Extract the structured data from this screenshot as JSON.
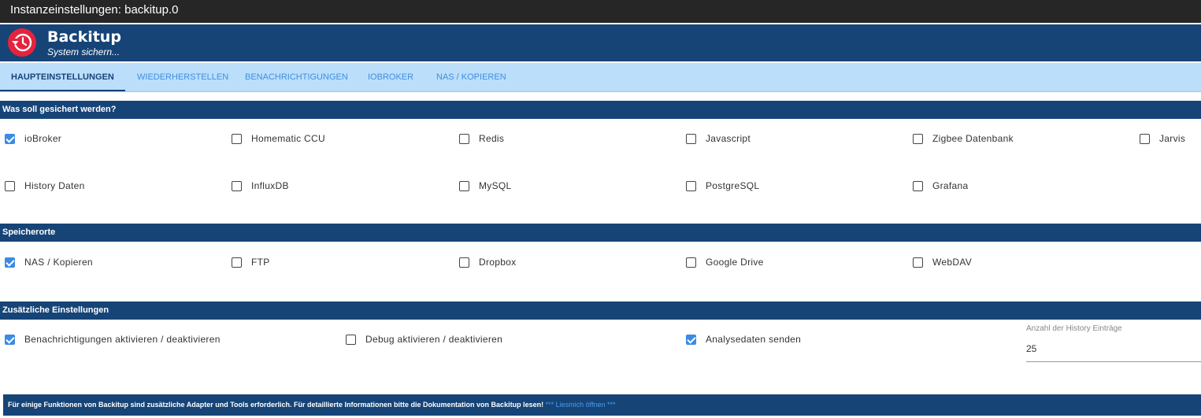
{
  "window": {
    "title": "Instanzeinstellungen: backitup.0"
  },
  "app": {
    "name": "Backitup",
    "subtitle": "System sichern..."
  },
  "tabs": [
    {
      "label": "HAUPTEINSTELLUNGEN",
      "active": true
    },
    {
      "label": "WIEDERHERSTELLEN",
      "active": false
    },
    {
      "label": "BENACHRICHTIGUNGEN",
      "active": false
    },
    {
      "label": "IOBROKER",
      "active": false
    },
    {
      "label": "NAS / KOPIEREN",
      "active": false
    }
  ],
  "sections": {
    "backup": {
      "title": "Was soll gesichert werden?",
      "items": [
        {
          "label": "ioBroker",
          "checked": true
        },
        {
          "label": "Homematic CCU",
          "checked": false
        },
        {
          "label": "Redis",
          "checked": false
        },
        {
          "label": "Javascript",
          "checked": false
        },
        {
          "label": "Zigbee Datenbank",
          "checked": false
        },
        {
          "label": "Jarvis",
          "checked": false
        },
        {
          "label": "History Daten",
          "checked": false
        },
        {
          "label": "InfluxDB",
          "checked": false
        },
        {
          "label": "MySQL",
          "checked": false
        },
        {
          "label": "PostgreSQL",
          "checked": false
        },
        {
          "label": "Grafana",
          "checked": false
        }
      ]
    },
    "storage": {
      "title": "Speicherorte",
      "items": [
        {
          "label": "NAS / Kopieren",
          "checked": true
        },
        {
          "label": "FTP",
          "checked": false
        },
        {
          "label": "Dropbox",
          "checked": false
        },
        {
          "label": "Google Drive",
          "checked": false
        },
        {
          "label": "WebDAV",
          "checked": false
        }
      ]
    },
    "extra": {
      "title": "Zusätzliche Einstellungen",
      "items": [
        {
          "label": "Benachrichtigungen aktivieren / deaktivieren",
          "checked": true
        },
        {
          "label": "Debug aktivieren / deaktivieren",
          "checked": false
        },
        {
          "label": "Analysedaten senden",
          "checked": true
        }
      ],
      "history": {
        "label": "Anzahl der History Einträge",
        "value": "25"
      }
    }
  },
  "footer": {
    "text": "Für einige Funktionen von Backitup sind zusätzliche Adapter und Tools erforderlich. Für detaillierte Informationen bitte die Dokumentation von Backitup lesen!",
    "link": "*** Liesmich öffnen ***"
  },
  "colors": {
    "header": "#164477",
    "tabbar": "#bbdefb",
    "accent": "#3b8be5",
    "logo": "#e5233d"
  }
}
